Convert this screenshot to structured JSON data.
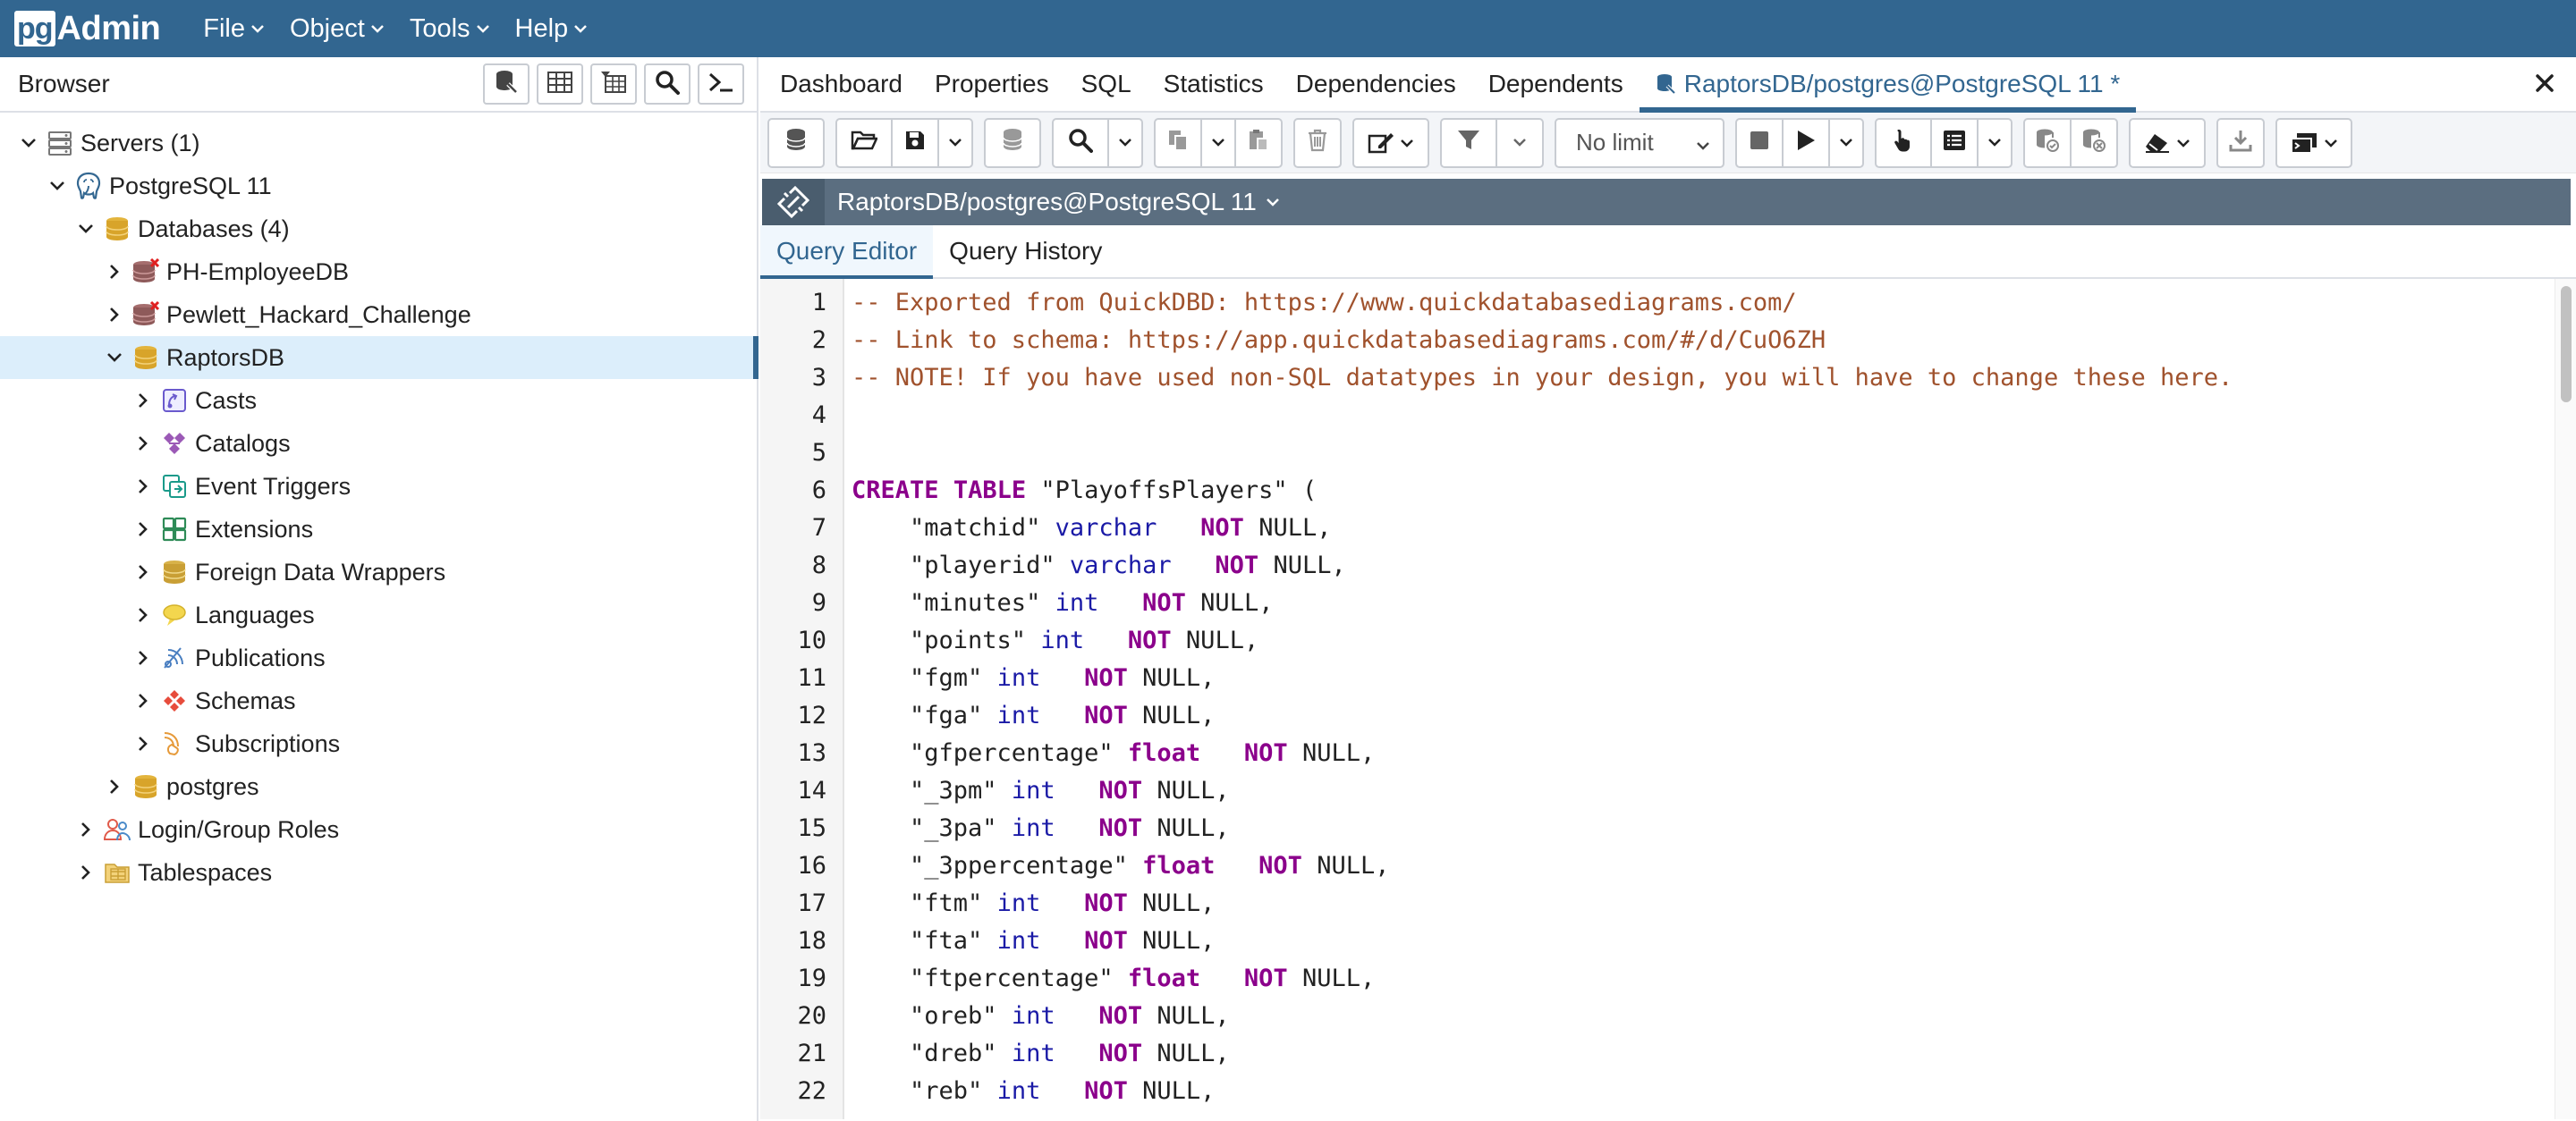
{
  "app": {
    "logo_pg": "pg",
    "logo_admin": "Admin"
  },
  "menu": [
    {
      "label": "File"
    },
    {
      "label": "Object"
    },
    {
      "label": "Tools"
    },
    {
      "label": "Help"
    }
  ],
  "browser": {
    "title": "Browser",
    "toolbar_icons": [
      "database-query-icon",
      "table-view-icon",
      "filtered-rows-icon",
      "search-icon",
      "psql-terminal-icon"
    ],
    "tree": [
      {
        "label": "Servers (1)",
        "level": 0,
        "expanded": true,
        "icon": "servers-icon"
      },
      {
        "label": "PostgreSQL 11",
        "level": 1,
        "expanded": true,
        "icon": "elephant-icon"
      },
      {
        "label": "Databases (4)",
        "level": 2,
        "expanded": true,
        "icon": "databases-icon"
      },
      {
        "label": "PH-EmployeeDB",
        "level": 3,
        "expanded": false,
        "icon": "database-disconnected-icon"
      },
      {
        "label": "Pewlett_Hackard_Challenge",
        "level": 3,
        "expanded": false,
        "icon": "database-disconnected-icon"
      },
      {
        "label": "RaptorsDB",
        "level": 3,
        "expanded": true,
        "icon": "database-icon",
        "selected": true
      },
      {
        "label": "Casts",
        "level": 4,
        "expanded": false,
        "icon": "casts-icon"
      },
      {
        "label": "Catalogs",
        "level": 4,
        "expanded": false,
        "icon": "catalogs-icon"
      },
      {
        "label": "Event Triggers",
        "level": 4,
        "expanded": false,
        "icon": "event-triggers-icon"
      },
      {
        "label": "Extensions",
        "level": 4,
        "expanded": false,
        "icon": "extensions-icon"
      },
      {
        "label": "Foreign Data Wrappers",
        "level": 4,
        "expanded": false,
        "icon": "foreign-data-wrappers-icon"
      },
      {
        "label": "Languages",
        "level": 4,
        "expanded": false,
        "icon": "languages-icon"
      },
      {
        "label": "Publications",
        "level": 4,
        "expanded": false,
        "icon": "publications-icon"
      },
      {
        "label": "Schemas",
        "level": 4,
        "expanded": false,
        "icon": "schemas-icon"
      },
      {
        "label": "Subscriptions",
        "level": 4,
        "expanded": false,
        "icon": "subscriptions-icon"
      },
      {
        "label": "postgres",
        "level": 3,
        "expanded": false,
        "icon": "database-icon"
      },
      {
        "label": "Login/Group Roles",
        "level": 2,
        "expanded": false,
        "icon": "roles-icon"
      },
      {
        "label": "Tablespaces",
        "level": 2,
        "expanded": false,
        "icon": "tablespaces-icon"
      }
    ]
  },
  "main": {
    "tabs": [
      {
        "label": "Dashboard"
      },
      {
        "label": "Properties"
      },
      {
        "label": "SQL"
      },
      {
        "label": "Statistics"
      },
      {
        "label": "Dependencies"
      },
      {
        "label": "Dependents"
      },
      {
        "label": "RaptorsDB/postgres@PostgreSQL 11 *",
        "active": true
      }
    ],
    "limit_label": "No limit",
    "connection_label": "RaptorsDB/postgres@PostgreSQL 11",
    "subtabs": [
      {
        "label": "Query Editor",
        "active": true
      },
      {
        "label": "Query History"
      }
    ],
    "code_lines": [
      [
        [
          "c",
          "-- Exported from QuickDBD: https://www.quickdatabasediagrams.com/"
        ]
      ],
      [
        [
          "c",
          "-- Link to schema: https://app.quickdatabasediagrams.com/#/d/CuO6ZH"
        ]
      ],
      [
        [
          "c",
          "-- NOTE! If you have used non-SQL datatypes in your design, you will have to change these here."
        ]
      ],
      [],
      [],
      [
        [
          "k",
          "CREATE"
        ],
        [
          "p",
          " "
        ],
        [
          "k",
          "TABLE"
        ],
        [
          "p",
          " \"PlayoffsPlayers\" ("
        ]
      ],
      [
        [
          "p",
          "    \"matchid\" "
        ],
        [
          "t",
          "varchar"
        ],
        [
          "p",
          "   "
        ],
        [
          "k",
          "NOT"
        ],
        [
          "p",
          " NULL,"
        ]
      ],
      [
        [
          "p",
          "    \"playerid\" "
        ],
        [
          "t",
          "varchar"
        ],
        [
          "p",
          "   "
        ],
        [
          "k",
          "NOT"
        ],
        [
          "p",
          " NULL,"
        ]
      ],
      [
        [
          "p",
          "    \"minutes\" "
        ],
        [
          "t",
          "int"
        ],
        [
          "p",
          "   "
        ],
        [
          "k",
          "NOT"
        ],
        [
          "p",
          " NULL,"
        ]
      ],
      [
        [
          "p",
          "    \"points\" "
        ],
        [
          "t",
          "int"
        ],
        [
          "p",
          "   "
        ],
        [
          "k",
          "NOT"
        ],
        [
          "p",
          " NULL,"
        ]
      ],
      [
        [
          "p",
          "    \"fgm\" "
        ],
        [
          "t",
          "int"
        ],
        [
          "p",
          "   "
        ],
        [
          "k",
          "NOT"
        ],
        [
          "p",
          " NULL,"
        ]
      ],
      [
        [
          "p",
          "    \"fga\" "
        ],
        [
          "t",
          "int"
        ],
        [
          "p",
          "   "
        ],
        [
          "k",
          "NOT"
        ],
        [
          "p",
          " NULL,"
        ]
      ],
      [
        [
          "p",
          "    \"gfpercentage\" "
        ],
        [
          "k",
          "float"
        ],
        [
          "p",
          "   "
        ],
        [
          "k",
          "NOT"
        ],
        [
          "p",
          " NULL,"
        ]
      ],
      [
        [
          "p",
          "    \"_3pm\" "
        ],
        [
          "t",
          "int"
        ],
        [
          "p",
          "   "
        ],
        [
          "k",
          "NOT"
        ],
        [
          "p",
          " NULL,"
        ]
      ],
      [
        [
          "p",
          "    \"_3pa\" "
        ],
        [
          "t",
          "int"
        ],
        [
          "p",
          "   "
        ],
        [
          "k",
          "NOT"
        ],
        [
          "p",
          " NULL,"
        ]
      ],
      [
        [
          "p",
          "    \"_3ppercentage\" "
        ],
        [
          "k",
          "float"
        ],
        [
          "p",
          "   "
        ],
        [
          "k",
          "NOT"
        ],
        [
          "p",
          " NULL,"
        ]
      ],
      [
        [
          "p",
          "    \"ftm\" "
        ],
        [
          "t",
          "int"
        ],
        [
          "p",
          "   "
        ],
        [
          "k",
          "NOT"
        ],
        [
          "p",
          " NULL,"
        ]
      ],
      [
        [
          "p",
          "    \"fta\" "
        ],
        [
          "t",
          "int"
        ],
        [
          "p",
          "   "
        ],
        [
          "k",
          "NOT"
        ],
        [
          "p",
          " NULL,"
        ]
      ],
      [
        [
          "p",
          "    \"ftpercentage\" "
        ],
        [
          "k",
          "float"
        ],
        [
          "p",
          "   "
        ],
        [
          "k",
          "NOT"
        ],
        [
          "p",
          " NULL,"
        ]
      ],
      [
        [
          "p",
          "    \"oreb\" "
        ],
        [
          "t",
          "int"
        ],
        [
          "p",
          "   "
        ],
        [
          "k",
          "NOT"
        ],
        [
          "p",
          " NULL,"
        ]
      ],
      [
        [
          "p",
          "    \"dreb\" "
        ],
        [
          "t",
          "int"
        ],
        [
          "p",
          "   "
        ],
        [
          "k",
          "NOT"
        ],
        [
          "p",
          " NULL,"
        ]
      ],
      [
        [
          "p",
          "    \"reb\" "
        ],
        [
          "t",
          "int"
        ],
        [
          "p",
          "   "
        ],
        [
          "k",
          "NOT"
        ],
        [
          "p",
          " NULL,"
        ]
      ]
    ]
  },
  "colors": {
    "brand": "#326690",
    "selected_row": "#dceefb",
    "connection_bar": "#5b6e80",
    "comment": "#a0522d",
    "keyword": "#8b008b",
    "type": "#1a1aa6"
  }
}
